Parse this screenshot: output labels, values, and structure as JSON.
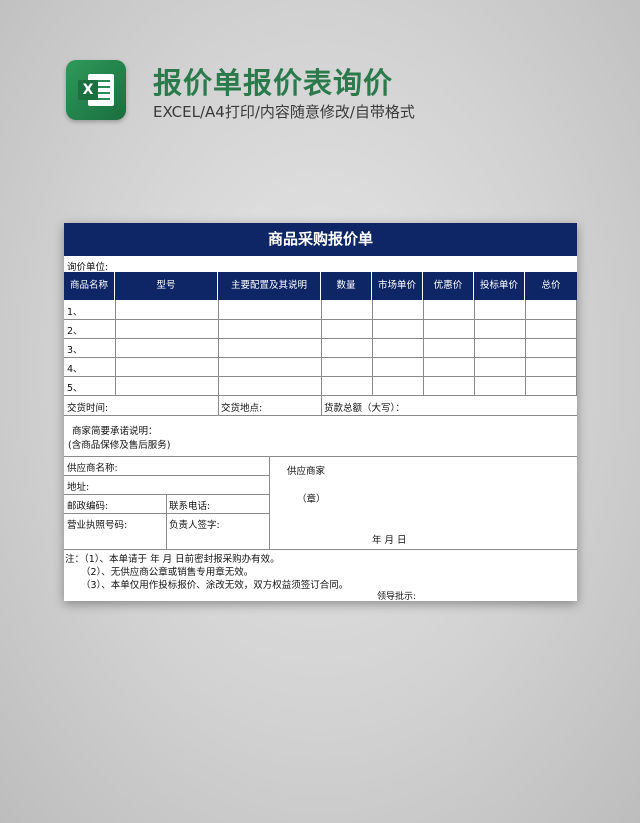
{
  "banner": {
    "title": "报价单报价表询价",
    "subtitle": "EXCEL/A4打印/内容随意修改/自带格式",
    "logo_letter": "X"
  },
  "form": {
    "title": "商品采购报价单",
    "inquiry_unit_label": "询价单位:",
    "columns": [
      "商品名称",
      "型号",
      "主要配置及其说明",
      "数量",
      "市场单价",
      "优惠价",
      "投标单价",
      "总价"
    ],
    "rows": [
      "1、",
      "2、",
      "3、",
      "4、",
      "5、"
    ],
    "delivery_time_label": "交货时间:",
    "delivery_place_label": "交货地点:",
    "total_amount_label": "货款总额（大写）：",
    "commitment_line1": "商家简要承诺说明：",
    "commitment_line2": "(含商品保修及售后服务)",
    "supplier_name_label": "供应商名称:",
    "address_label": "地址:",
    "postcode_label": "邮政编码:",
    "phone_label": "联系电话:",
    "license_label": "营业执照号码:",
    "signer_label": "负责人签字:",
    "supplier_label": "供应商家",
    "seal_label": "（章）",
    "date_label": "年  月  日",
    "note1": "注：（1）、本单请于     年    月    日前密封报采购办有效。",
    "note2": "（2）、无供应商公章或销售专用章无效。",
    "note3": "（3）、本单仅用作投标报价、涂改无效，双方权益须签订合同。",
    "approval_label": "领导批示:"
  },
  "colors": {
    "header_navy": "#0e2566",
    "banner_green": "#2a7a4c"
  }
}
